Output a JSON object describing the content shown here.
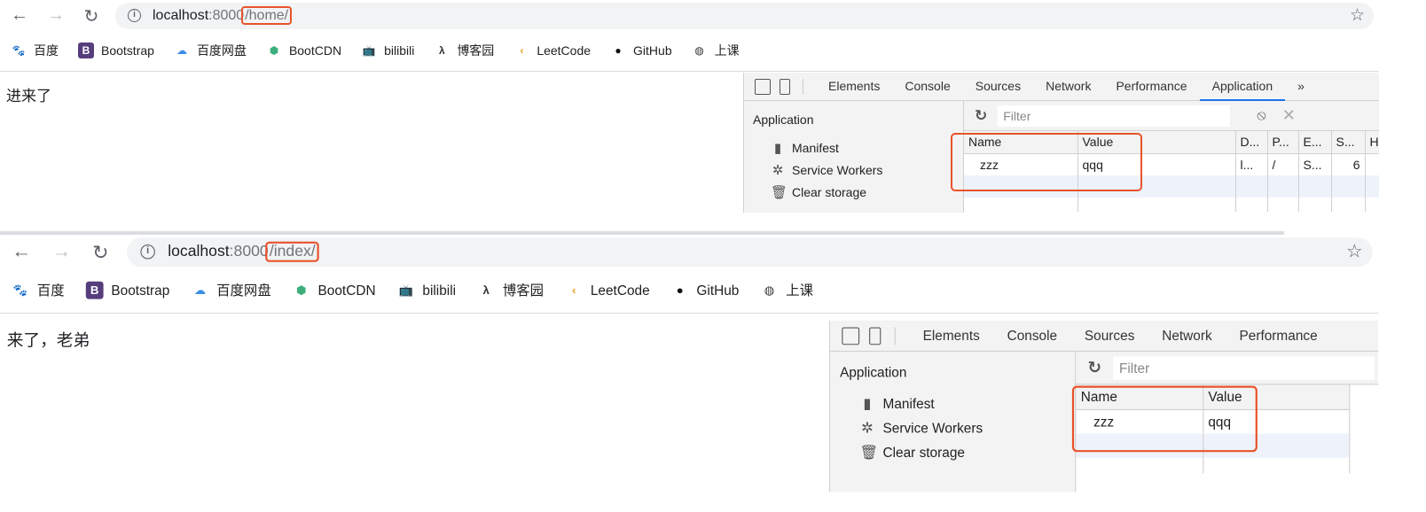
{
  "accent": "#e8532c",
  "bookmarks": [
    {
      "label": "百度",
      "icon": "baidu-paw-icon"
    },
    {
      "label": "Bootstrap",
      "icon": "bootstrap-b-icon"
    },
    {
      "label": "百度网盘",
      "icon": "baidu-netdisk-icon"
    },
    {
      "label": "BootCDN",
      "icon": "bootcdn-icon"
    },
    {
      "label": "bilibili",
      "icon": "bilibili-tv-icon"
    },
    {
      "label": "博客园",
      "icon": "cnblogs-icon"
    },
    {
      "label": "LeetCode",
      "icon": "leetcode-icon"
    },
    {
      "label": "GitHub",
      "icon": "github-octocat-icon"
    },
    {
      "label": "上课",
      "icon": "globe-icon"
    }
  ],
  "devtools": {
    "tabs": [
      "Elements",
      "Console",
      "Sources",
      "Network",
      "Performance",
      "Application"
    ],
    "more": "»",
    "sidebar_header": "Application",
    "sidebar_items": [
      "Manifest",
      "Service Workers",
      "Clear storage"
    ],
    "filter_placeholder": "Filter"
  },
  "panels": [
    {
      "url_host": "localhost",
      "url_port": ":8000",
      "url_path": "/home/",
      "page_text": "进来了",
      "columns": [
        "Name",
        "Value",
        "D...",
        "P...",
        "E...",
        "S...",
        "H"
      ],
      "rows": [
        [
          "zzz",
          "qqq",
          "l...",
          "/",
          "S...",
          "6",
          ""
        ]
      ]
    },
    {
      "url_host": "localhost",
      "url_port": ":8000",
      "url_path": "/index/",
      "page_text": "来了，老弟",
      "columns": [
        "Name",
        "Value"
      ],
      "rows": [
        [
          "zzz",
          "qqq"
        ]
      ]
    }
  ]
}
